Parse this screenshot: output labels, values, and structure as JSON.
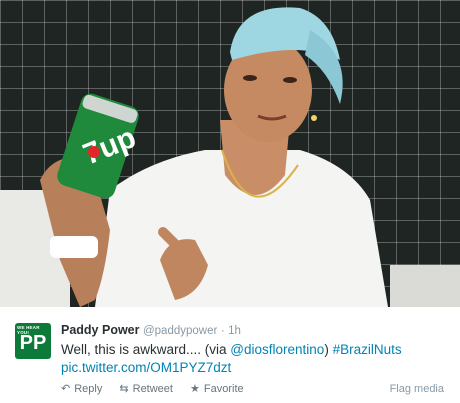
{
  "photo": {
    "can_logo": "7up"
  },
  "tweet": {
    "avatar_tag": "WE HEAR YOU!",
    "avatar_letters": "PP",
    "display_name": "Paddy Power",
    "handle": "@paddypower",
    "separator": "·",
    "time": "1h",
    "text_prefix": "Well, this is awkward.... (via ",
    "mention": "@diosflorentino",
    "text_mid": ") ",
    "hashtag": "#BrazilNuts",
    "link": "pic.twitter.com/OM1PYZ7dzt",
    "actions": [
      {
        "label": "Reply",
        "icon": "reply-icon"
      },
      {
        "label": "Retweet",
        "icon": "retweet-icon"
      },
      {
        "label": "Favorite",
        "icon": "favorite-icon"
      }
    ],
    "flag_media": "Flag media"
  }
}
